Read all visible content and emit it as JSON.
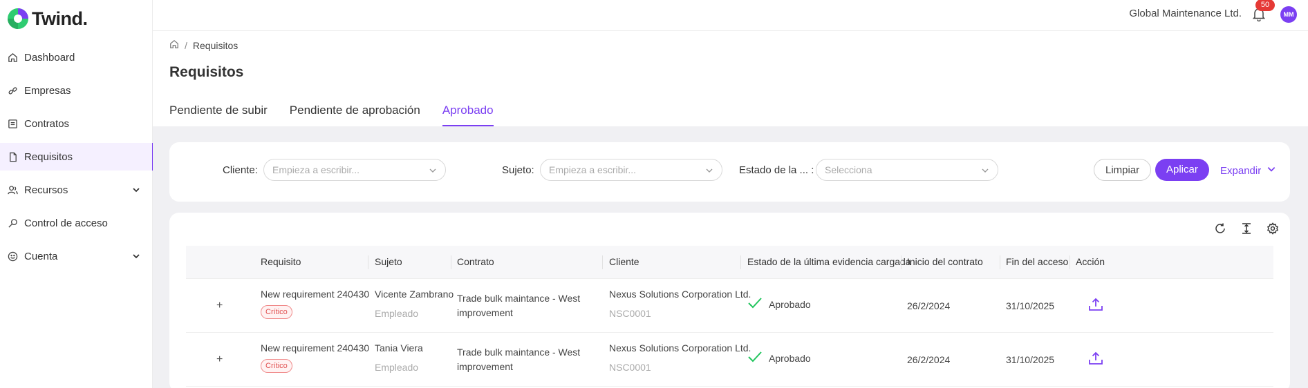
{
  "brand": {
    "name": "Twind."
  },
  "sidebar": {
    "items": [
      {
        "label": "Dashboard",
        "icon": "home-icon"
      },
      {
        "label": "Empresas",
        "icon": "link-icon"
      },
      {
        "label": "Contratos",
        "icon": "contract-icon"
      },
      {
        "label": "Requisitos",
        "icon": "document-icon",
        "active": true
      },
      {
        "label": "Recursos",
        "icon": "users-icon",
        "expandable": true
      },
      {
        "label": "Control de acceso",
        "icon": "key-icon"
      },
      {
        "label": "Cuenta",
        "icon": "smile-icon",
        "expandable": true
      }
    ]
  },
  "header": {
    "company": "Global Maintenance Ltd.",
    "notifications": "50",
    "avatar": "MM"
  },
  "breadcrumb": {
    "current": "Requisitos",
    "separator": "/"
  },
  "page": {
    "title": "Requisitos"
  },
  "tabs": [
    {
      "label": "Pendiente de subir"
    },
    {
      "label": "Pendiente de aprobación"
    },
    {
      "label": "Aprobado",
      "active": true
    }
  ],
  "filters": {
    "cliente": {
      "label": "Cliente",
      "placeholder": "Empieza a escribir..."
    },
    "sujeto": {
      "label": "Sujeto",
      "placeholder": "Empieza a escribir..."
    },
    "estado": {
      "label": "Estado de la ...",
      "placeholder": "Selecciona"
    },
    "clear": "Limpiar",
    "apply": "Aplicar",
    "expand": "Expandir"
  },
  "table": {
    "columns": [
      "Requisito",
      "Sujeto",
      "Contrato",
      "Cliente",
      "Estado de la última evidencia cargada",
      "Inicio del contrato",
      "Fin del acceso",
      "Acción"
    ],
    "rows": [
      {
        "requirement": "New requirement 240430",
        "tag": "Crítico",
        "subject": "Vicente Zambrano",
        "subject_role": "Empleado",
        "contract_line1": "Trade bulk maintance - West",
        "contract_line2": "improvement",
        "client": "Nexus Solutions Corporation Ltd.",
        "client_code": "NSC0001",
        "status": "Aprobado",
        "start": "26/2/2024",
        "end": "31/10/2025"
      },
      {
        "requirement": "New requirement 240430",
        "tag": "Crítico",
        "subject": "Tania Viera",
        "subject_role": "Empleado",
        "contract_line1": "Trade bulk maintance - West",
        "contract_line2": "improvement",
        "client": "Nexus Solutions Corporation Ltd.",
        "client_code": "NSC0001",
        "status": "Aprobado",
        "start": "26/2/2024",
        "end": "31/10/2025"
      }
    ]
  },
  "colors": {
    "accent": "#7b3ff2",
    "success": "#22c55e",
    "danger": "#e53935"
  }
}
